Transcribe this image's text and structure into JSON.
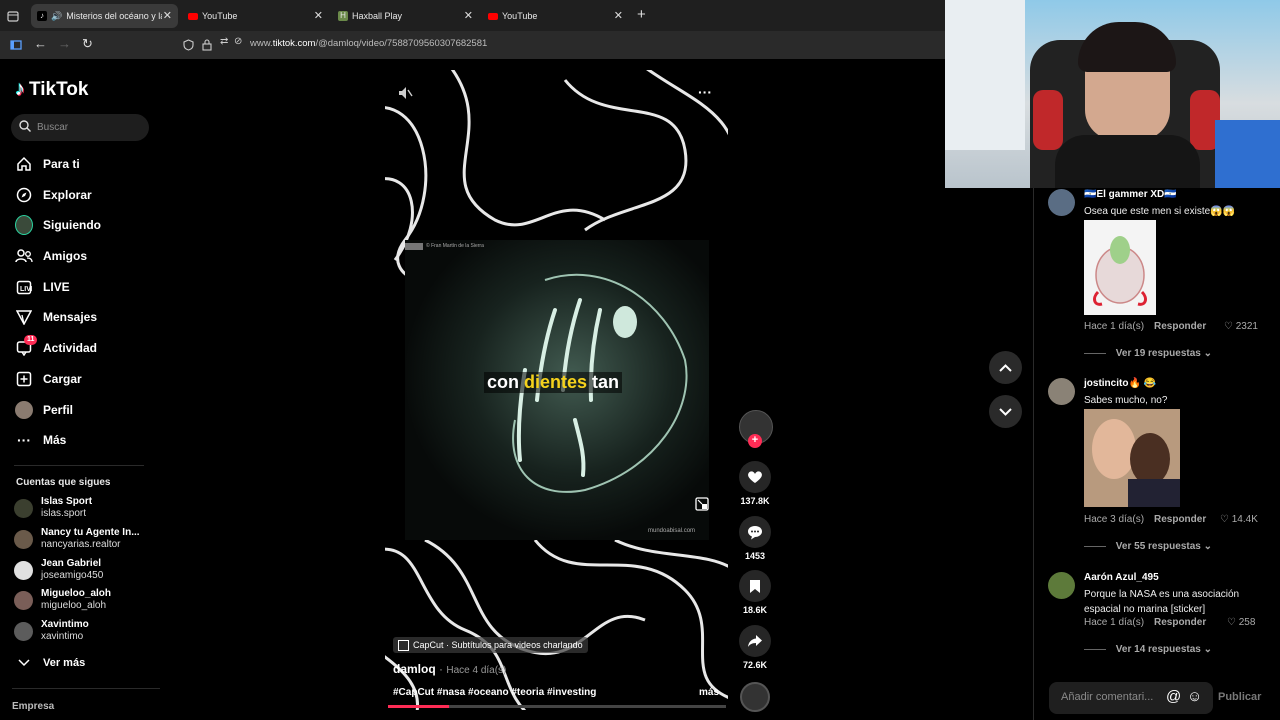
{
  "browser": {
    "tabs": [
      {
        "label": "Misterios del océano y la le",
        "active": true
      },
      {
        "label": "YouTube",
        "active": false
      },
      {
        "label": "Haxball Play",
        "active": false
      },
      {
        "label": "YouTube",
        "active": false
      }
    ],
    "url_prefix": "www.",
    "url_domain": "tiktok.com",
    "url_path": "/@damloq/video/7588709560307682581"
  },
  "sidebar": {
    "logo": "TikTok",
    "search_placeholder": "Buscar",
    "nav": [
      {
        "label": "Para ti",
        "icon": "home-icon"
      },
      {
        "label": "Explorar",
        "icon": "compass-icon"
      },
      {
        "label": "Siguiendo",
        "icon": "following-avatar-icon"
      },
      {
        "label": "Amigos",
        "icon": "friends-icon"
      },
      {
        "label": "LIVE",
        "icon": "live-icon"
      },
      {
        "label": "Mensajes",
        "icon": "messages-icon"
      },
      {
        "label": "Actividad",
        "icon": "activity-icon",
        "badge": "11"
      },
      {
        "label": "Cargar",
        "icon": "upload-icon"
      },
      {
        "label": "Perfil",
        "icon": "profile-avatar-icon"
      },
      {
        "label": "Más",
        "icon": "more-icon"
      }
    ],
    "following_title": "Cuentas que sigues",
    "accounts": [
      {
        "name": "Islas Sport",
        "handle": "islas.sport"
      },
      {
        "name": "Nancy tu Agente In...",
        "handle": "nancyarias.realtor"
      },
      {
        "name": "Jean Gabriel",
        "handle": "joseamigo450"
      },
      {
        "name": "Migueloo_aloh",
        "handle": "migueloo_aloh"
      },
      {
        "name": "Xavintimo",
        "handle": "xavintimo"
      }
    ],
    "see_more": "Ver más",
    "footer": "Empresa"
  },
  "video": {
    "watermark": "© Fran Martín de la Sierra",
    "caption_pre": "con ",
    "caption_highlight": "dientes",
    "caption_post": " tan",
    "site_mark": "mundoabisal.com",
    "capcut": "CapCut · Subtítulos para videos charlando",
    "author": "damloq",
    "time": "Hace 4 día(s)",
    "hashtags": "#CapCut #nasa #oceano #teoria #investing",
    "more": "más",
    "progress": 0.18
  },
  "actions": {
    "likes": "137.8K",
    "comments": "1453",
    "saves": "18.6K",
    "shares": "72.6K"
  },
  "comments": [
    {
      "user": "🇸🇻El gammer XD🇸🇻",
      "text": "Osea que este men si existe😱😱",
      "time": "Hace 1 día(s)",
      "reply": "Responder",
      "likes": "2321",
      "more_replies": "Ver 19 respuestas"
    },
    {
      "user": "jostincito🔥 😂",
      "text": "Sabes mucho, no?",
      "time": "Hace 3 día(s)",
      "reply": "Responder",
      "likes": "14.4K",
      "more_replies": "Ver 55 respuestas"
    },
    {
      "user": "Aarón Azul_495",
      "text": "Porque la NASA es una asociación espacial no marina [sticker]",
      "time": "Hace 1 día(s)",
      "reply": "Responder",
      "likes": "258",
      "more_replies": "Ver 14 respuestas"
    }
  ],
  "comment_input": {
    "placeholder": "Añadir comentari...",
    "publish": "Publicar"
  }
}
